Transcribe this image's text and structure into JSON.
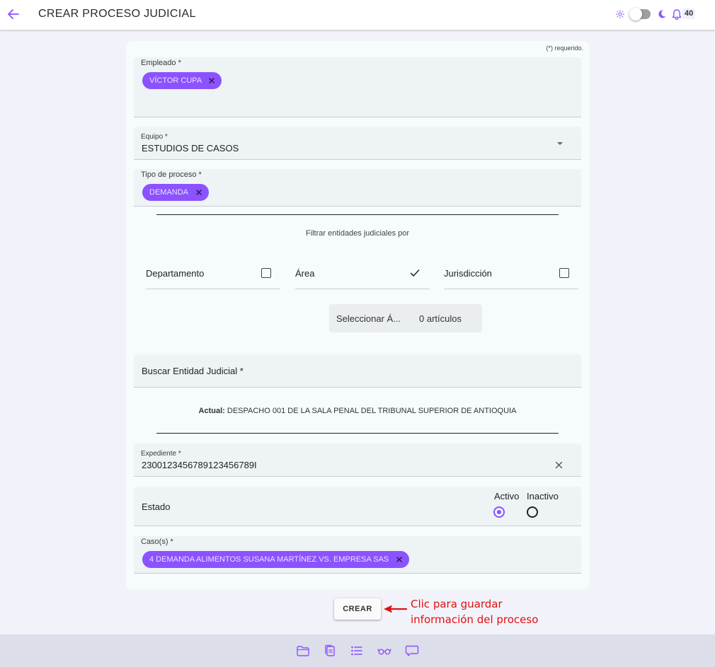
{
  "header": {
    "title": "CREAR PROCESO JUDICIAL",
    "notification_count": "40",
    "icons": [
      "back-arrow-icon",
      "sun-icon",
      "theme-toggle",
      "moon-icon",
      "bell-icon"
    ]
  },
  "form": {
    "required_note": "(*) requerido.",
    "empleado": {
      "label": "Empleado *",
      "chip": "VÍCTOR CUPA"
    },
    "equipo": {
      "label": "Equipo *",
      "value": "ESTUDIOS DE CASOS"
    },
    "tipo_proceso": {
      "label": "Tipo de proceso *",
      "chip": "DEMANDA"
    },
    "filter": {
      "title": "Filtrar entidades judiciales por",
      "options": [
        {
          "label": "Departamento",
          "checked": false
        },
        {
          "label": "Área",
          "checked": true
        },
        {
          "label": "Jurisdicción",
          "checked": false
        }
      ],
      "select_label": "Seleccionar Á...",
      "select_count": "0 artículos"
    },
    "buscar_entidad": {
      "label": "Buscar Entidad Judicial *"
    },
    "actual": {
      "prefix": "Actual:",
      "value": "DESPACHO 001 DE LA SALA PENAL DEL TRIBUNAL SUPERIOR DE ANTIOQUIA"
    },
    "expediente": {
      "label": "Expediente *",
      "value": "2300123456789123456789I"
    },
    "estado": {
      "label": "Estado",
      "options": [
        "Activo",
        "Inactivo"
      ],
      "selected": "Activo"
    },
    "casos": {
      "label": "Caso(s) *",
      "chip": "4 DEMANDA ALIMENTOS SUSANA MARTÍNEZ VS. EMPRESA SAS"
    },
    "submit_label": "CREAR"
  },
  "annotation": {
    "line1": "Clic para guardar",
    "line2": "información del proceso"
  },
  "bottom_nav": [
    "folder-icon",
    "documents-icon",
    "list-icon",
    "glasses-icon",
    "chat-icon"
  ],
  "colors": {
    "accent": "#8c52ff",
    "annotation": "#e01010"
  }
}
